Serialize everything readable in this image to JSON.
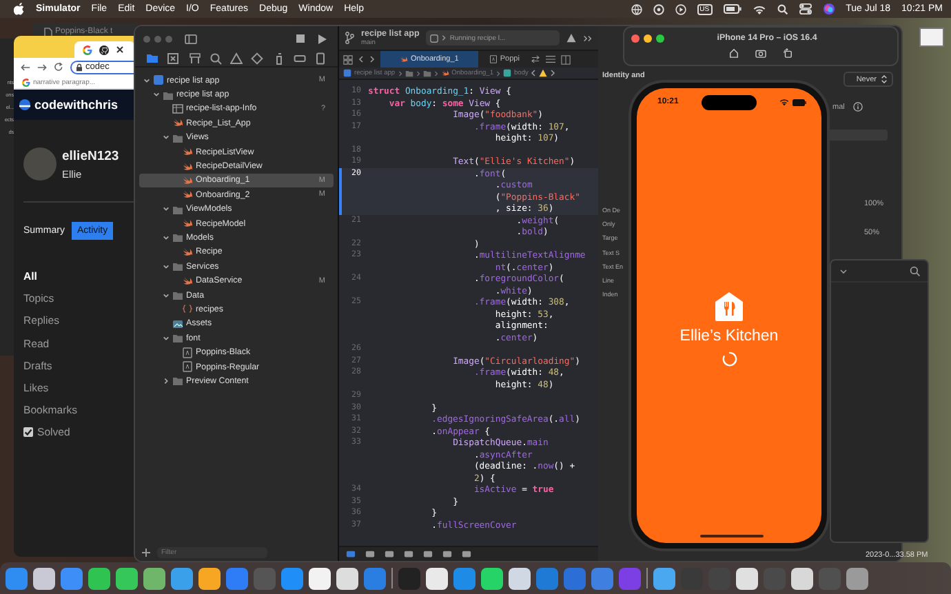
{
  "menu_bar": {
    "app_name": "Simulator",
    "menus": [
      "File",
      "Edit",
      "Device",
      "I/O",
      "Features",
      "Debug",
      "Window",
      "Help"
    ],
    "input_source": "US",
    "date": "Tue Jul 18",
    "time": "10:21 PM"
  },
  "background_window": {
    "labels": [
      "nts",
      "ons",
      "el...",
      "ects",
      "ds"
    ]
  },
  "browser_behind": {
    "tab_title": "Poppins-Black t"
  },
  "browser": {
    "address": "codec",
    "bookmark": "narrative paragrap...",
    "site_name": "codewithchris",
    "username": "ellieN123",
    "display_name": "Ellie",
    "tabs": [
      {
        "label": "Summary",
        "selected": false
      },
      {
        "label": "Activity",
        "selected": true
      }
    ],
    "filters": [
      {
        "label": "All",
        "selected": true
      },
      {
        "label": "Topics",
        "selected": false
      },
      {
        "label": "Replies",
        "selected": false
      },
      {
        "label": "Read",
        "selected": false
      },
      {
        "label": "Drafts",
        "selected": false
      },
      {
        "label": "Likes",
        "selected": false
      },
      {
        "label": "Bookmarks",
        "selected": false
      }
    ],
    "solved_filter": {
      "label": "Solved",
      "checked": true
    }
  },
  "xcode": {
    "project": "recipe list app",
    "branch": "main",
    "run_status": "Running recipe l...",
    "navigator": {
      "filter_placeholder": "Filter",
      "tree": [
        {
          "label": "recipe list app",
          "kind": "project",
          "selected": false,
          "expanded": true,
          "badge": "M",
          "children": [
            {
              "label": "recipe list app",
              "kind": "folder",
              "selected": false,
              "expanded": true,
              "children": [
                {
                  "label": "recipe-list-app-Info",
                  "kind": "plist",
                  "selected": false,
                  "badge": "?"
                },
                {
                  "label": "Recipe_List_App",
                  "kind": "swift",
                  "selected": false
                },
                {
                  "label": "Views",
                  "kind": "folder",
                  "selected": false,
                  "expanded": true,
                  "children": [
                    {
                      "label": "RecipeListView",
                      "kind": "swift",
                      "selected": false
                    },
                    {
                      "label": "RecipeDetailView",
                      "kind": "swift",
                      "selected": false
                    },
                    {
                      "label": "Onboarding_1",
                      "kind": "swift",
                      "selected": true,
                      "badge": "M"
                    },
                    {
                      "label": "Onboarding_2",
                      "kind": "swift",
                      "selected": false,
                      "badge": "M"
                    }
                  ]
                },
                {
                  "label": "ViewModels",
                  "kind": "folder",
                  "selected": false,
                  "expanded": true,
                  "children": [
                    {
                      "label": "RecipeModel",
                      "kind": "swift",
                      "selected": false
                    }
                  ]
                },
                {
                  "label": "Models",
                  "kind": "folder",
                  "selected": false,
                  "expanded": true,
                  "children": [
                    {
                      "label": "Recipe",
                      "kind": "swift",
                      "selected": false
                    }
                  ]
                },
                {
                  "label": "Services",
                  "kind": "folder",
                  "selected": false,
                  "expanded": true,
                  "children": [
                    {
                      "label": "DataService",
                      "kind": "swift",
                      "selected": false,
                      "badge": "M"
                    }
                  ]
                },
                {
                  "label": "Data",
                  "kind": "folder",
                  "selected": false,
                  "expanded": true,
                  "children": [
                    {
                      "label": "recipes",
                      "kind": "json",
                      "selected": false
                    }
                  ]
                },
                {
                  "label": "Assets",
                  "kind": "assets",
                  "selected": false
                },
                {
                  "label": "font",
                  "kind": "folder",
                  "selected": false,
                  "expanded": true,
                  "children": [
                    {
                      "label": "Poppins-Black",
                      "kind": "font",
                      "selected": false
                    },
                    {
                      "label": "Poppins-Regular",
                      "kind": "font",
                      "selected": false
                    }
                  ]
                },
                {
                  "label": "Preview Content",
                  "kind": "folder",
                  "selected": false,
                  "expanded": false
                }
              ]
            }
          ]
        }
      ]
    },
    "editor_tabs": [
      {
        "label": "Onboarding_1",
        "selected": true
      },
      {
        "label": "Poppi",
        "selected": false
      }
    ],
    "breadcrumb": [
      {
        "kind": "project",
        "label": "recipe list app"
      },
      {
        "kind": "folder"
      },
      {
        "kind": "folder"
      },
      {
        "kind": "swift",
        "label": "Onboarding_1"
      },
      {
        "kind": "symbol",
        "label": "body"
      }
    ],
    "lines": [
      {
        "number": "10",
        "current": false,
        "rows": [
          {
            "segments": [
              {
                "kind": "keyword",
                "text": "struct "
              },
              {
                "kind": "type",
                "text": "Onboarding_1"
              },
              {
                "kind": "plain",
                "text": ": "
              },
              {
                "kind": "class",
                "text": "View"
              },
              {
                "kind": "plain",
                "text": " {"
              }
            ]
          }
        ]
      },
      {
        "number": "13",
        "current": false,
        "rows": [
          {
            "segments": [
              {
                "kind": "keyword",
                "text": "    var "
              },
              {
                "kind": "type",
                "text": "body"
              },
              {
                "kind": "plain",
                "text": ": "
              },
              {
                "kind": "keyword",
                "text": "some "
              },
              {
                "kind": "class",
                "text": "View"
              },
              {
                "kind": "plain",
                "text": " {"
              }
            ]
          }
        ]
      },
      {
        "number": "16",
        "current": false,
        "rows": [
          {
            "segments": [
              {
                "kind": "class",
                "text": "                Image"
              },
              {
                "kind": "plain",
                "text": "("
              },
              {
                "kind": "string",
                "text": "\"foodbank\""
              },
              {
                "kind": "plain",
                "text": ")"
              }
            ]
          }
        ]
      },
      {
        "number": "17",
        "current": false,
        "rows": [
          {
            "segments": [
              {
                "kind": "member",
                "text": "                    .frame"
              },
              {
                "kind": "plain",
                "text": "(width: "
              },
              {
                "kind": "number",
                "text": "107"
              },
              {
                "kind": "plain",
                "text": ","
              }
            ]
          },
          {
            "segments": [
              {
                "kind": "plain",
                "text": "                        height: "
              },
              {
                "kind": "number",
                "text": "107"
              },
              {
                "kind": "plain",
                "text": ")"
              }
            ]
          }
        ]
      },
      {
        "number": "18",
        "current": false
      },
      {
        "number": "19",
        "current": false,
        "rows": [
          {
            "segments": [
              {
                "kind": "class",
                "text": "                Text"
              },
              {
                "kind": "plain",
                "text": "("
              },
              {
                "kind": "string",
                "text": "\"Ellie's Kitchen\""
              },
              {
                "kind": "plain",
                "text": ")"
              }
            ]
          }
        ]
      },
      {
        "number": "20",
        "current": true,
        "rows": [
          {
            "segments": [
              {
                "kind": "plain",
                "text": "                    ."
              },
              {
                "kind": "member",
                "text": "font"
              },
              {
                "kind": "plain",
                "text": "("
              }
            ]
          },
          {
            "segments": [
              {
                "kind": "plain",
                "text": "                        ."
              },
              {
                "kind": "member",
                "text": "custom"
              }
            ]
          },
          {
            "segments": [
              {
                "kind": "plain",
                "text": "                        ("
              },
              {
                "kind": "string",
                "text": "\"Poppins-Black\""
              }
            ]
          },
          {
            "segments": [
              {
                "kind": "plain",
                "text": "                        , size: "
              },
              {
                "kind": "number",
                "text": "36"
              },
              {
                "kind": "plain",
                "text": ")"
              }
            ]
          }
        ]
      },
      {
        "number": "21",
        "current": false,
        "rows": [
          {
            "segments": [
              {
                "kind": "plain",
                "text": "                            ."
              },
              {
                "kind": "member",
                "text": "weight"
              },
              {
                "kind": "plain",
                "text": "("
              }
            ]
          },
          {
            "segments": [
              {
                "kind": "plain",
                "text": "                            ."
              },
              {
                "kind": "member",
                "text": "bold"
              },
              {
                "kind": "plain",
                "text": ")"
              }
            ]
          }
        ]
      },
      {
        "number": "22",
        "current": false,
        "rows": [
          {
            "segments": [
              {
                "kind": "plain",
                "text": "                    )"
              }
            ]
          }
        ]
      },
      {
        "number": "23",
        "current": false,
        "rows": [
          {
            "segments": [
              {
                "kind": "plain",
                "text": "                    ."
              },
              {
                "kind": "member",
                "text": "multilineTextAlignme"
              }
            ]
          },
          {
            "segments": [
              {
                "kind": "member",
                "text": "                        nt"
              },
              {
                "kind": "plain",
                "text": "(."
              },
              {
                "kind": "member",
                "text": "center"
              },
              {
                "kind": "plain",
                "text": ")"
              }
            ]
          }
        ]
      },
      {
        "number": "24",
        "current": false,
        "rows": [
          {
            "segments": [
              {
                "kind": "plain",
                "text": "                    ."
              },
              {
                "kind": "member",
                "text": "foregroundColor"
              },
              {
                "kind": "plain",
                "text": "("
              }
            ]
          },
          {
            "segments": [
              {
                "kind": "plain",
                "text": "                        ."
              },
              {
                "kind": "member",
                "text": "white"
              },
              {
                "kind": "plain",
                "text": ")"
              }
            ]
          }
        ]
      },
      {
        "number": "25",
        "current": false,
        "rows": [
          {
            "segments": [
              {
                "kind": "member",
                "text": "                    .frame"
              },
              {
                "kind": "plain",
                "text": "(width: "
              },
              {
                "kind": "number",
                "text": "308"
              },
              {
                "kind": "plain",
                "text": ","
              }
            ]
          },
          {
            "segments": [
              {
                "kind": "plain",
                "text": "                        height: "
              },
              {
                "kind": "number",
                "text": "53"
              },
              {
                "kind": "plain",
                "text": ","
              }
            ]
          },
          {
            "segments": [
              {
                "kind": "plain",
                "text": "                        alignment:"
              }
            ]
          },
          {
            "segments": [
              {
                "kind": "plain",
                "text": "                        ."
              },
              {
                "kind": "member",
                "text": "center"
              },
              {
                "kind": "plain",
                "text": ")"
              }
            ]
          }
        ]
      },
      {
        "number": "26",
        "current": false
      },
      {
        "number": "27",
        "current": false,
        "rows": [
          {
            "segments": [
              {
                "kind": "class",
                "text": "                Image"
              },
              {
                "kind": "plain",
                "text": "("
              },
              {
                "kind": "string",
                "text": "\"Circularloading\""
              },
              {
                "kind": "plain",
                "text": ")"
              }
            ]
          }
        ]
      },
      {
        "number": "28",
        "current": false,
        "rows": [
          {
            "segments": [
              {
                "kind": "member",
                "text": "                    .frame"
              },
              {
                "kind": "plain",
                "text": "(width: "
              },
              {
                "kind": "number",
                "text": "48"
              },
              {
                "kind": "plain",
                "text": ","
              }
            ]
          },
          {
            "segments": [
              {
                "kind": "plain",
                "text": "                        height: "
              },
              {
                "kind": "number",
                "text": "48"
              },
              {
                "kind": "plain",
                "text": ")"
              }
            ]
          }
        ]
      },
      {
        "number": "29",
        "current": false
      },
      {
        "number": "30",
        "current": false,
        "rows": [
          {
            "segments": [
              {
                "kind": "plain",
                "text": "            }"
              }
            ]
          }
        ]
      },
      {
        "number": "31",
        "current": false,
        "rows": [
          {
            "segments": [
              {
                "kind": "member",
                "text": "            .edgesIgnoringSafeArea"
              },
              {
                "kind": "plain",
                "text": "(."
              },
              {
                "kind": "member",
                "text": "all"
              },
              {
                "kind": "plain",
                "text": ")"
              }
            ]
          }
        ]
      },
      {
        "number": "32",
        "current": false,
        "rows": [
          {
            "segments": [
              {
                "kind": "plain",
                "text": "            ."
              },
              {
                "kind": "member",
                "text": "onAppear"
              },
              {
                "kind": "plain",
                "text": " {"
              }
            ]
          }
        ]
      },
      {
        "number": "33",
        "current": false,
        "rows": [
          {
            "segments": [
              {
                "kind": "class",
                "text": "                DispatchQueue"
              },
              {
                "kind": "plain",
                "text": "."
              },
              {
                "kind": "member",
                "text": "main"
              }
            ]
          },
          {
            "segments": [
              {
                "kind": "plain",
                "text": "                    ."
              },
              {
                "kind": "member",
                "text": "asyncAfter"
              }
            ]
          },
          {
            "segments": [
              {
                "kind": "plain",
                "text": "                    (deadline: ."
              },
              {
                "kind": "member",
                "text": "now"
              },
              {
                "kind": "plain",
                "text": "() +"
              }
            ]
          },
          {
            "segments": [
              {
                "kind": "number",
                "text": "                    2"
              },
              {
                "kind": "plain",
                "text": ") {"
              }
            ]
          }
        ]
      },
      {
        "number": "34",
        "current": false,
        "rows": [
          {
            "segments": [
              {
                "kind": "member",
                "text": "                    isActive"
              },
              {
                "kind": "plain",
                "text": " = "
              },
              {
                "kind": "keyword",
                "text": "true"
              }
            ]
          }
        ]
      },
      {
        "number": "35",
        "current": false,
        "rows": [
          {
            "segments": [
              {
                "kind": "plain",
                "text": "                }"
              }
            ]
          }
        ]
      },
      {
        "number": "36",
        "current": false,
        "rows": [
          {
            "segments": [
              {
                "kind": "plain",
                "text": "            }"
              }
            ]
          }
        ]
      },
      {
        "number": "37",
        "current": false,
        "rows": [
          {
            "segments": [
              {
                "kind": "plain",
                "text": "            ."
              },
              {
                "kind": "member",
                "text": "fullScreenCover"
              }
            ]
          }
        ]
      }
    ],
    "inspector": {
      "title": "Identity and",
      "left_labels": [
        "On De",
        "Only",
        "Targe",
        "Text S",
        "Text En",
        "Line",
        "Inden"
      ],
      "visibility_value": "Never",
      "style_value": "mal",
      "percent_labels": [
        "100%",
        "50%"
      ]
    }
  },
  "simulator": {
    "title": "iPhone 14 Pro – iOS 16.4",
    "status_time": "10:21",
    "app_title": "Ellie’s Kitchen"
  },
  "desktop": {
    "file_label": "2023-0...33.58 PM"
  },
  "dock": [
    {
      "kind": "app",
      "color": "#2f8cf0"
    },
    {
      "kind": "app",
      "color": "#c9c9d6"
    },
    {
      "kind": "app",
      "color": "#3d8ef7"
    },
    {
      "kind": "app",
      "color": "#2fc352"
    },
    {
      "kind": "app",
      "color": "#35c759"
    },
    {
      "kind": "app",
      "color": "#6fb66b"
    },
    {
      "kind": "app",
      "color": "#3aa0ea"
    },
    {
      "kind": "app",
      "color": "#f6a623"
    },
    {
      "kind": "app",
      "color": "#2f7df6"
    },
    {
      "kind": "app",
      "color": "#555555"
    },
    {
      "kind": "app",
      "color": "#1f8ef7"
    },
    {
      "kind": "app",
      "color": "#f2f2f2"
    },
    {
      "kind": "app",
      "color": "#dddddd"
    },
    {
      "kind": "app",
      "color": "#2a7de1"
    },
    {
      "kind": "divider"
    },
    {
      "kind": "app",
      "color": "#222222"
    },
    {
      "kind": "app",
      "color": "#e9e9e9"
    },
    {
      "kind": "app",
      "color": "#1e8ce6"
    },
    {
      "kind": "app",
      "color": "#25d366"
    },
    {
      "kind": "app",
      "color": "#cfd8e3"
    },
    {
      "kind": "app",
      "color": "#1f7ad6"
    },
    {
      "kind": "app",
      "color": "#2b6fd6"
    },
    {
      "kind": "app",
      "color": "#3e7fe0"
    },
    {
      "kind": "app",
      "color": "#7b3fe4"
    },
    {
      "kind": "divider"
    },
    {
      "kind": "app",
      "color": "#4aa8f0"
    },
    {
      "kind": "app",
      "color": "#3a3a3a"
    },
    {
      "kind": "app",
      "color": "#444444"
    },
    {
      "kind": "app",
      "color": "#e0e0e0"
    },
    {
      "kind": "app",
      "color": "#4a4a4a"
    },
    {
      "kind": "app",
      "color": "#d8d8d8"
    },
    {
      "kind": "app",
      "color": "#505050"
    },
    {
      "kind": "app",
      "color": "#9a9a9a"
    }
  ]
}
